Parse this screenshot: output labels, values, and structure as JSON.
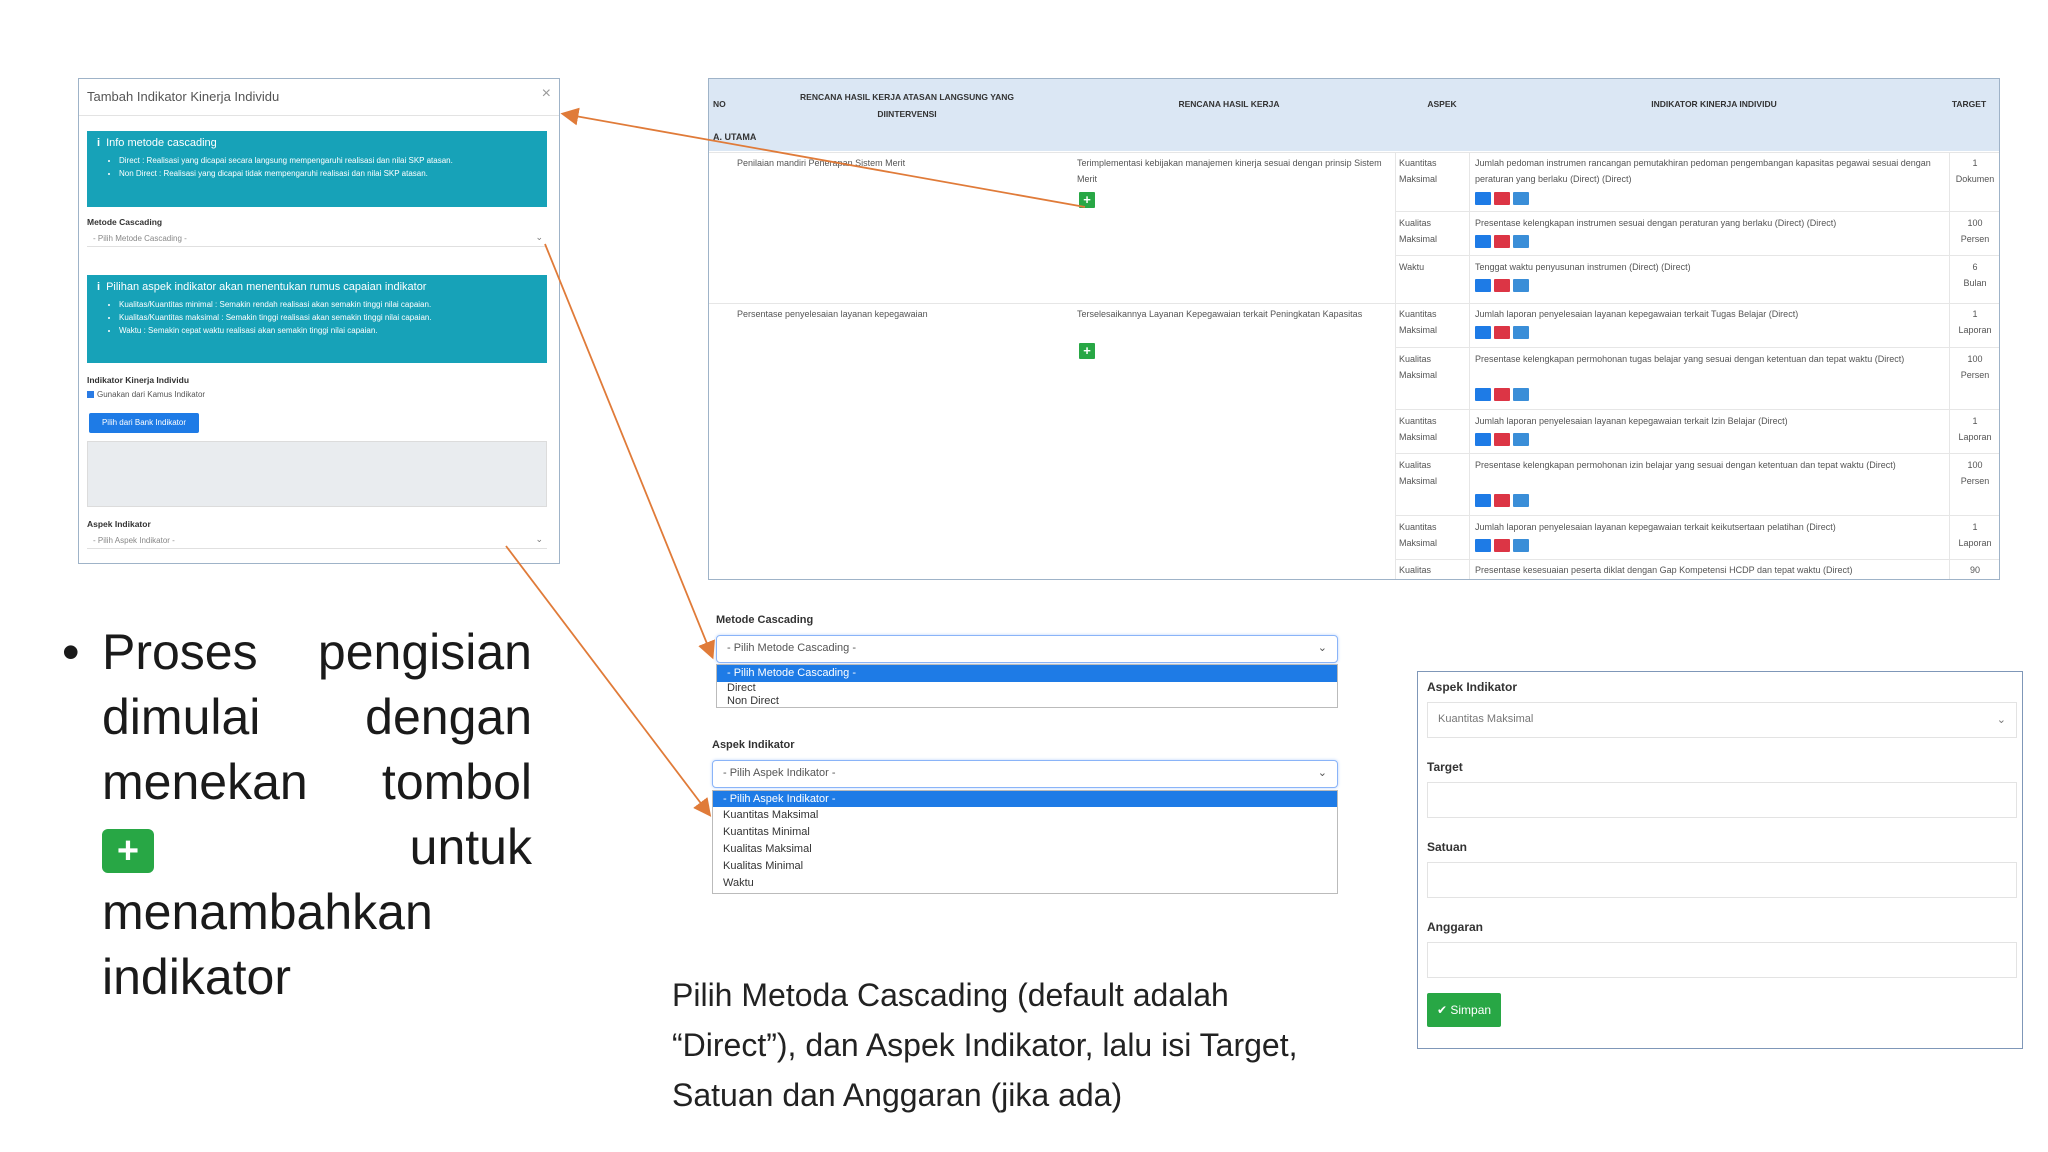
{
  "modal": {
    "title": "Tambah Indikator Kinerja Individu",
    "close": "×",
    "info1_title": "Info metode cascading",
    "info1_items": [
      "Direct : Realisasi yang dicapai secara langsung mempengaruhi realisasi dan nilai SKP atasan.",
      "Non Direct : Realisasi yang dicapai tidak mempengaruhi realisasi dan nilai SKP atasan."
    ],
    "metode_label": "Metode Cascading",
    "metode_placeholder": "- Pilih Metode Cascading -",
    "info2_title": "Pilihan aspek indikator akan menentukan rumus capaian indikator",
    "info2_items": [
      "Kualitas/Kuantitas minimal : Semakin rendah realisasi akan semakin tinggi nilai capaian.",
      "Kualitas/Kuantitas maksimal : Semakin tinggi realisasi akan semakin tinggi nilai capaian.",
      "Waktu : Semakin cepat waktu realisasi akan semakin tinggi nilai capaian."
    ],
    "iki_label": "Indikator Kinerja Individu",
    "checkbox_label": "Gunakan dari Kamus Indikator",
    "bank_button": "Pilih dari Bank Indikator",
    "aspek_label": "Aspek Indikator",
    "aspek_placeholder": "- Pilih Aspek Indikator -"
  },
  "bullet": {
    "dot": "•",
    "part1": "Proses pengisian dimulai dengan menekan tombol",
    "plus": "+",
    "part2": "untuk menambahkan indikator"
  },
  "table": {
    "headers": {
      "no": "NO",
      "rhk_atasan": "RENCANA HASIL KERJA ATASAN LANGSUNG YANG DIINTERVENSI",
      "rhk": "RENCANA HASIL KERJA",
      "aspek": "ASPEK",
      "iki": "INDIKATOR KINERJA INDIVIDU",
      "target": "TARGET"
    },
    "section": "A. UTAMA",
    "plus": "+",
    "groups": [
      {
        "atasan": "Penilaian mandiri Penerapan Sistem Merit",
        "rhk": "Terimplementasi kebijakan manajemen kinerja sesuai dengan prinsip Sistem Merit"
      },
      {
        "atasan": "Persentase penyelesaian layanan kepegawaian",
        "rhk": "Terselesaikannya Layanan Kepegawaian terkait Peningkatan Kapasitas"
      }
    ],
    "rows": [
      {
        "aspek": "Kuantitas Maksimal",
        "iki": "Jumlah pedoman instrumen rancangan pemutakhiran pedoman pengembangan kapasitas pegawai sesuai dengan peraturan yang berlaku (Direct) (Direct)",
        "target_v": "1",
        "target_u": "Dokumen"
      },
      {
        "aspek": "Kualitas Maksimal",
        "iki": "Presentase kelengkapan instrumen sesuai dengan peraturan yang berlaku (Direct) (Direct)",
        "target_v": "100",
        "target_u": "Persen"
      },
      {
        "aspek": "Waktu",
        "iki": "Tenggat waktu penyusunan instrumen (Direct) (Direct)",
        "target_v": "6",
        "target_u": "Bulan"
      },
      {
        "aspek": "Kuantitas Maksimal",
        "iki": "Jumlah laporan penyelesaian layanan kepegawaian terkait Tugas Belajar (Direct)",
        "target_v": "1",
        "target_u": "Laporan"
      },
      {
        "aspek": "Kualitas Maksimal",
        "iki": "Presentase kelengkapan permohonan tugas belajar yang sesuai dengan ketentuan dan tepat waktu (Direct)",
        "target_v": "100",
        "target_u": "Persen"
      },
      {
        "aspek": "Kuantitas Maksimal",
        "iki": "Jumlah laporan penyelesaian layanan kepegawaian terkait Izin Belajar (Direct)",
        "target_v": "1",
        "target_u": "Laporan"
      },
      {
        "aspek": "Kualitas Maksimal",
        "iki": "Presentase kelengkapan permohonan izin belajar yang sesuai dengan ketentuan dan tepat waktu (Direct)",
        "target_v": "100",
        "target_u": "Persen"
      },
      {
        "aspek": "Kuantitas Maksimal",
        "iki": "Jumlah laporan penyelesaian layanan kepegawaian terkait keikutsertaan pelatihan (Direct)",
        "target_v": "1",
        "target_u": "Laporan"
      },
      {
        "aspek": "Kualitas",
        "iki": "Presentase kesesuaian peserta diklat dengan Gap Kompetensi HCDP dan tepat waktu (Direct)",
        "target_v": "90",
        "target_u": ""
      }
    ]
  },
  "cascade": {
    "label": "Metode Cascading",
    "selected": "- Pilih Metode Cascading -",
    "options": [
      "- Pilih Metode Cascading -",
      "Direct",
      "Non Direct"
    ]
  },
  "aspek_dd": {
    "label": "Aspek Indikator",
    "selected": "- Pilih Aspek Indikator -",
    "options": [
      "- Pilih Aspek Indikator -",
      "Kuantitas Maksimal",
      "Kuantitas Minimal",
      "Kualitas Maksimal",
      "Kualitas Minimal",
      "Waktu"
    ]
  },
  "form": {
    "aspek_label": "Aspek Indikator",
    "aspek_value": "Kuantitas Maksimal",
    "target_label": "Target",
    "satuan_label": "Satuan",
    "anggaran_label": "Anggaran",
    "save_label": "Simpan",
    "save_icon": "✔"
  },
  "caption": {
    "line1": "Pilih Metoda Cascading (default adalah",
    "line2": "“Direct”), dan Aspek Indikator, lalu isi Target,",
    "line3": "Satuan dan Anggaran (jika ada)"
  },
  "colors": {
    "info": "#17a2b8",
    "primary": "#1e7be6",
    "success": "#28a745",
    "danger": "#dc3545",
    "arrow": "#e07b39",
    "table_header": "#dbe7f4"
  },
  "icons": {
    "chevron": "chevron-down-icon",
    "info": "info-icon",
    "check": "check-icon"
  }
}
